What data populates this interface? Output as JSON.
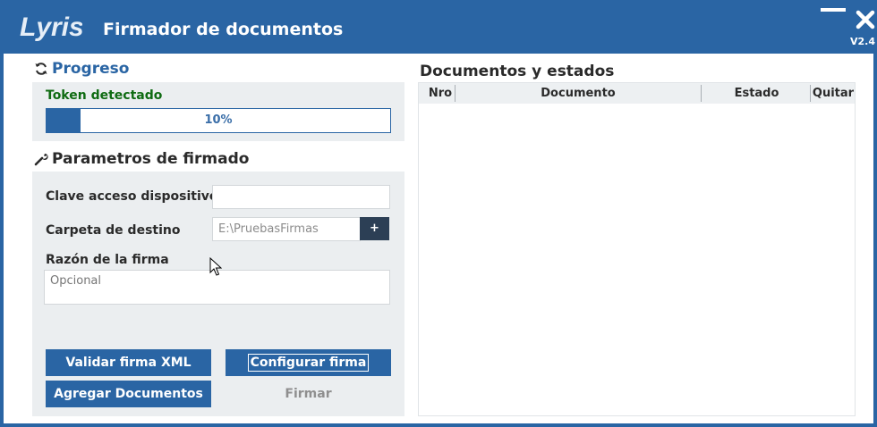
{
  "window": {
    "title": "Firmador de documentos",
    "version": "V2.4",
    "logo_text": "Lyris",
    "accent_color": "#2a65a4"
  },
  "progress_section": {
    "title": "Progreso",
    "icon": "refresh-icon",
    "status_text": "Token detectado",
    "status_color": "#0f6b12",
    "progress_value": 0.1,
    "progress_label": "10%"
  },
  "params_section": {
    "title": "Parametros de firmado",
    "icon": "wrench-icon",
    "device_password_label": "Clave acceso dispositivo",
    "device_password_value": "",
    "destination_label": "Carpeta de destino",
    "destination_value": "E:\\PruebasFirmas",
    "browse_label": "+",
    "reason_label": "Razón de la firma",
    "reason_placeholder": "Opcional"
  },
  "actions": {
    "validate_xml": "Validar firma XML",
    "configure_signature": "Configurar firma",
    "add_documents": "Agregar Documentos",
    "sign": "Firmar"
  },
  "documents": {
    "title": "Documentos y estados",
    "columns": [
      "Nro",
      "Documento",
      "Estado",
      "Quitar"
    ],
    "rows": []
  }
}
